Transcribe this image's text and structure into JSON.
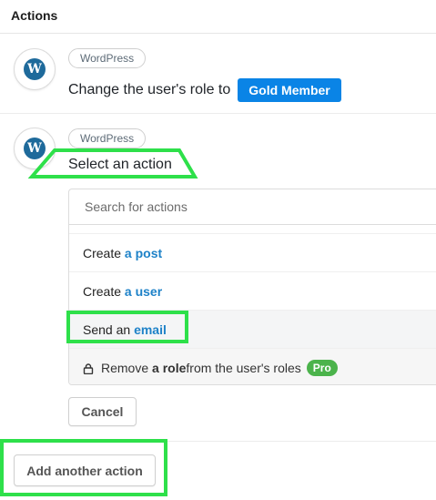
{
  "header": {
    "title": "Actions"
  },
  "action1": {
    "integration": "WordPress",
    "text": "Change the user's role to",
    "role_badge": "Gold Member"
  },
  "action2": {
    "integration": "WordPress",
    "prompt": "Select an action",
    "search_placeholder": "Search for actions",
    "options": [
      {
        "prefix": "Create ",
        "highlight": "a post",
        "suffix": ""
      },
      {
        "prefix": "Create ",
        "highlight": "a user",
        "suffix": ""
      },
      {
        "prefix": "Send an ",
        "highlight": "email",
        "suffix": ""
      },
      {
        "prefix": "Remove ",
        "highlight": "a role",
        "suffix": " from the user's roles",
        "badge": "Pro"
      }
    ],
    "cancel_label": "Cancel"
  },
  "footer": {
    "add_label": "Add another action"
  },
  "colors": {
    "accent": "#0a84e6",
    "link": "#1e82c8",
    "pro": "#4bb34b",
    "highlight_annotation": "#2ee04a"
  }
}
